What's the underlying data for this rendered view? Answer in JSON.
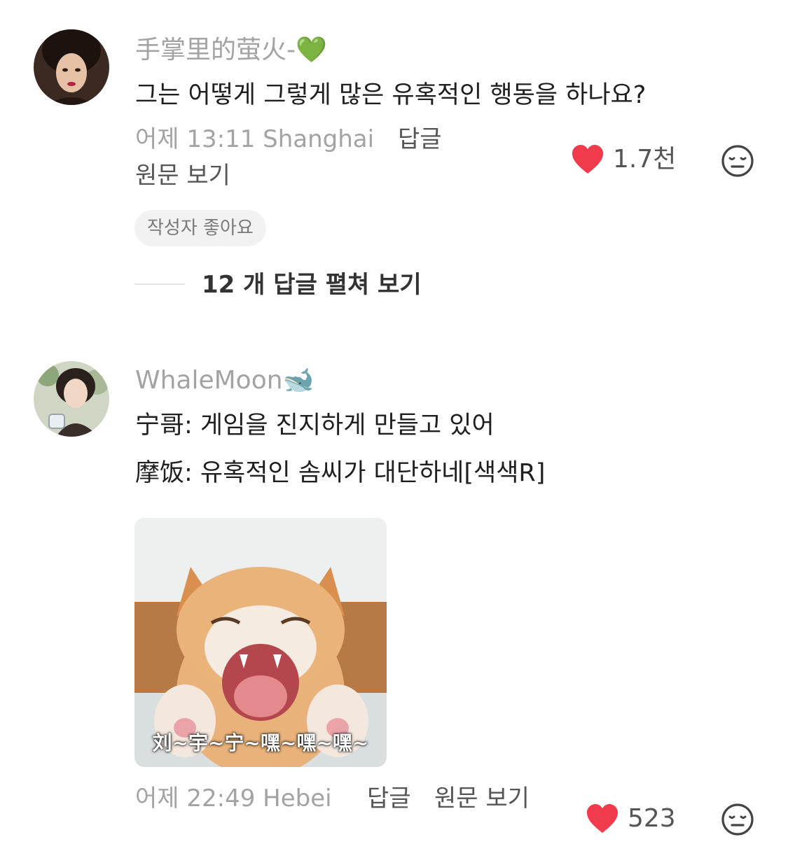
{
  "comments": [
    {
      "username": "手掌里的萤火-",
      "username_emoji": "💚",
      "text": "그는 어떻게 그렇게 많은 유혹적인 행동을 하나요?",
      "meta": "어제 13:11 Shanghai",
      "reply_label": "답글",
      "view_original_label": "원문 보기",
      "like_count": "1.7천",
      "author_liked_badge": "작성자 좋아요",
      "expand_replies_label": "12 개 답글 펼쳐 보기"
    },
    {
      "username": "WhaleMoon",
      "username_emoji": "🐋",
      "lines": [
        "宁哥: 게임을 진지하게 만들고 있어",
        "摩饭: 유혹적인 솜씨가 대단하네[색색R]"
      ],
      "sticker_caption": "刘~宇~宁~嘿~嘿~嘿~",
      "meta": "어제 22:49 Hebei",
      "reply_label": "답글",
      "view_original_label": "원문 보기",
      "like_count": "523"
    }
  ],
  "colors": {
    "heart": "#f23a4d",
    "muted_text": "#a3a3a3",
    "body_text": "#1f1f1f"
  },
  "icons": {
    "like": "heart-icon",
    "dislike": "neutral-face-icon"
  }
}
